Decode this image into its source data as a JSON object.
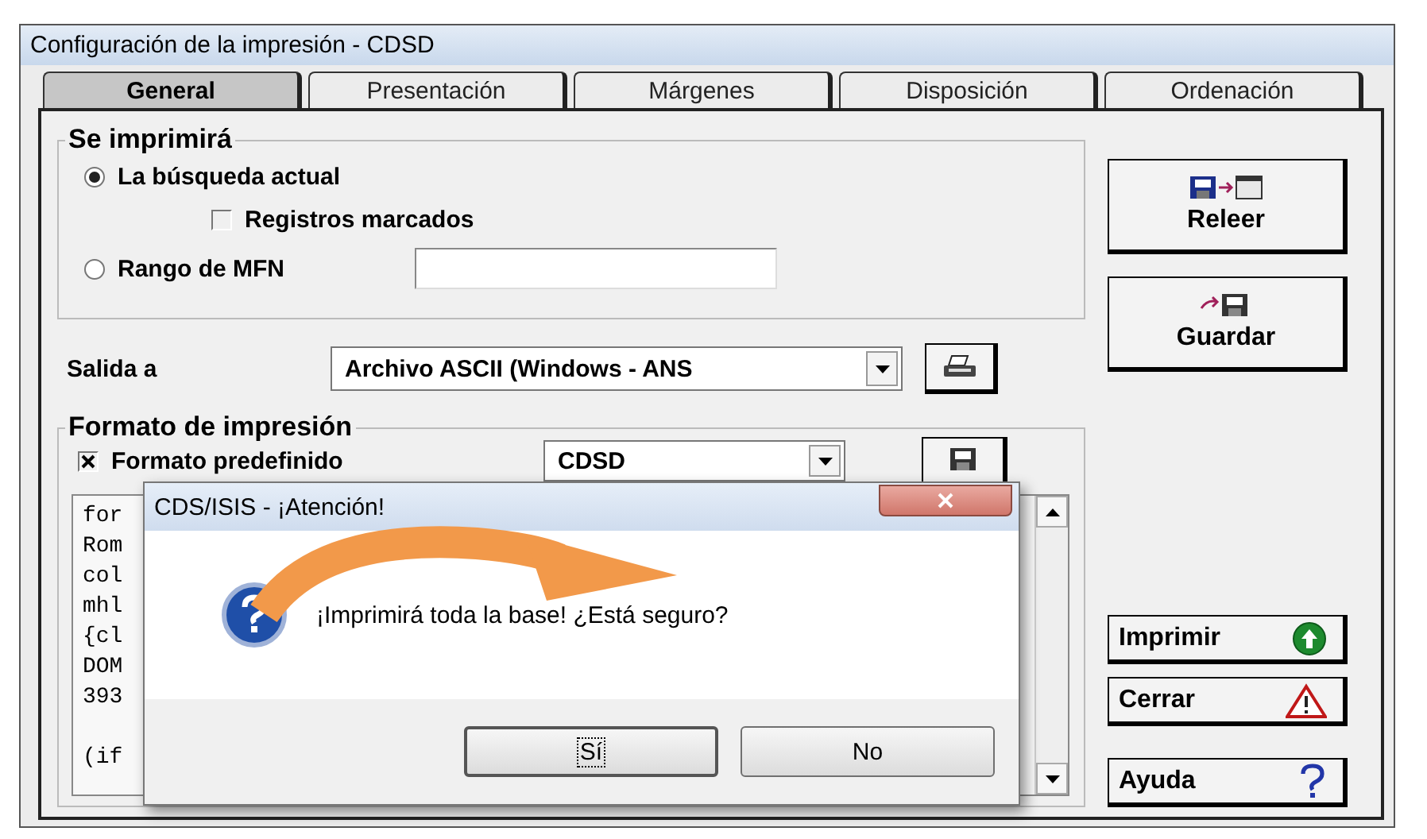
{
  "window": {
    "title": "Configuración de la impresión - CDSD"
  },
  "tabs": [
    {
      "label": "General",
      "selected": true
    },
    {
      "label": "Presentación",
      "selected": false
    },
    {
      "label": "Márgenes",
      "selected": false
    },
    {
      "label": "Disposición",
      "selected": false
    },
    {
      "label": "Ordenación",
      "selected": false
    }
  ],
  "print_scope": {
    "title": "Se imprimirá",
    "current_search": {
      "label": "La búsqueda actual",
      "selected": true
    },
    "marked_records": {
      "label": "Registros marcados",
      "checked": false
    },
    "mfn_range": {
      "label": "Rango de MFN",
      "selected": false
    }
  },
  "output": {
    "label": "Salida a",
    "value": "Archivo ASCII (Windows - ANS"
  },
  "format": {
    "title": "Formato de impresión",
    "predefined": {
      "label": "Formato predefinido",
      "checked": true
    },
    "value": "CDSD",
    "paragraphs": [
      [
        "for",
        "Rom",
        "col",
        "mhl",
        "{cl",
        "DOM",
        "393"
      ],
      [
        "(if"
      ]
    ]
  },
  "side_buttons": [
    {
      "kind": "reload",
      "label": "Releer"
    },
    {
      "kind": "save",
      "label": "Guardar"
    },
    {
      "kind": "print",
      "label": "Imprimir"
    },
    {
      "kind": "close",
      "label": "Cerrar"
    },
    {
      "kind": "help",
      "label": "Ayuda"
    }
  ],
  "dialog": {
    "title": "CDS/ISIS - ¡Atención!",
    "message": "¡Imprimirá toda la base! ¿Está seguro?",
    "buttons": [
      {
        "label": "Sí",
        "selected": true
      },
      {
        "label": "No",
        "selected": false
      }
    ]
  }
}
